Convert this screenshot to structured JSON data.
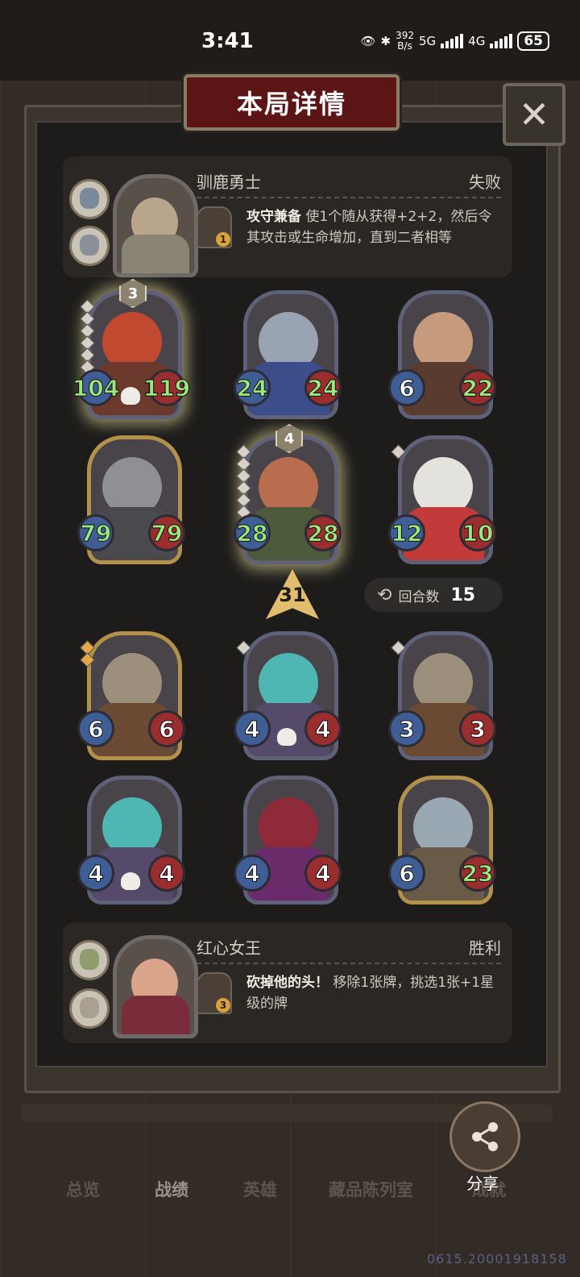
{
  "status_bar": {
    "time": "3:41",
    "net_speed_value": "392",
    "net_speed_unit": "B/s",
    "net_type_1": "5G",
    "net_type_2": "4G",
    "battery": "65"
  },
  "dialog": {
    "title": "本局详情",
    "close_icon": "close-x-icon"
  },
  "opponent": {
    "name": "驯鹿勇士",
    "result": "失败",
    "ability_name": "攻守兼备",
    "ability_desc": "使1个随从获得+2+2，然后令其攻击或生命增加，直到二者相等",
    "ability_level": "1"
  },
  "opponent_units": [
    {
      "tier": "3",
      "attack": "104",
      "health": "119",
      "gold": false,
      "glow": true,
      "stars": 7,
      "star_color": "silver",
      "skull": true
    },
    {
      "tier": "",
      "attack": "24",
      "health": "24",
      "gold": false,
      "glow": false,
      "stars": 0,
      "skull": false
    },
    {
      "tier": "",
      "attack": "6",
      "health": "22",
      "gold": false,
      "glow": false,
      "stars": 0,
      "skull": false
    },
    {
      "tier": "",
      "attack": "79",
      "health": "79",
      "gold": true,
      "glow": false,
      "stars": 0,
      "skull": false
    },
    {
      "tier": "4",
      "attack": "28",
      "health": "28",
      "gold": false,
      "glow": true,
      "stars": 6,
      "star_color": "silver",
      "skull": false
    },
    {
      "tier": "",
      "attack": "12",
      "health": "10",
      "gold": false,
      "glow": false,
      "stars": 1,
      "star_color": "silver",
      "skull": false
    }
  ],
  "damage": "31",
  "round": {
    "label": "回合数",
    "value": "15"
  },
  "player_units": [
    {
      "attack": "6",
      "health": "6",
      "gold": true,
      "stars": 2,
      "star_color": "gold",
      "skull": false
    },
    {
      "attack": "4",
      "health": "4",
      "gold": false,
      "stars": 1,
      "star_color": "silver",
      "skull": true
    },
    {
      "attack": "3",
      "health": "3",
      "gold": false,
      "stars": 1,
      "star_color": "silver",
      "skull": false
    },
    {
      "attack": "4",
      "health": "4",
      "gold": false,
      "stars": 0,
      "skull": true
    },
    {
      "attack": "4",
      "health": "4",
      "gold": false,
      "stars": 0,
      "skull": false
    },
    {
      "attack": "6",
      "health": "23",
      "gold": true,
      "stars": 0,
      "skull": false
    }
  ],
  "player": {
    "name": "红心女王",
    "result": "胜利",
    "ability_name": "砍掉他的头！",
    "ability_desc": "移除1张牌，挑选1张+1星级的牌",
    "ability_level": "3"
  },
  "bottom_nav": [
    "总览",
    "战绩",
    "英雄",
    "藏品陈列室",
    "成就"
  ],
  "share_label": "分享",
  "watermark": "0615.20001918158",
  "colors": {
    "title_plate": "#5b1515",
    "attack_badge": "#3e5e95",
    "health_badge": "#9a2d2d",
    "buffed_stat": "#9be87d",
    "damage_arrow": "#e3bd6e"
  }
}
